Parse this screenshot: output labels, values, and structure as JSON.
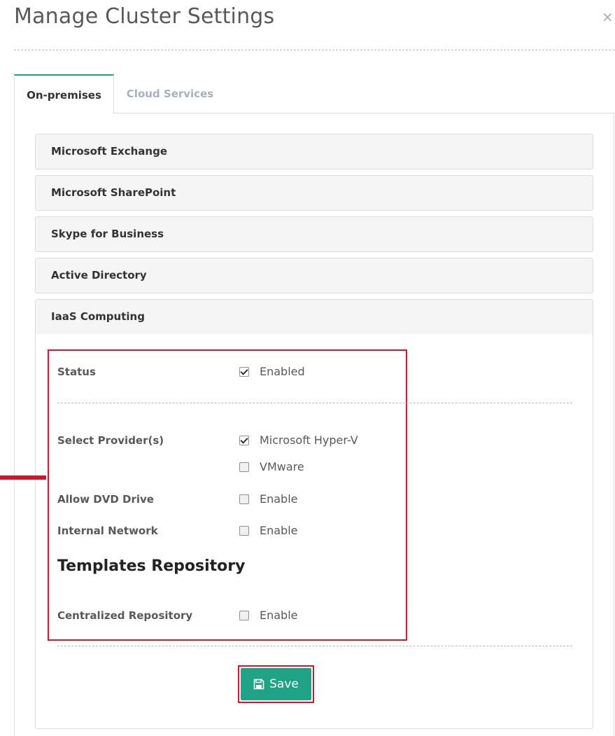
{
  "dialog": {
    "title": "Manage Cluster Settings",
    "close_glyph": "×"
  },
  "tabs": [
    {
      "label": "On-premises",
      "active": true
    },
    {
      "label": "Cloud Services",
      "active": false
    }
  ],
  "accordion": {
    "items": [
      {
        "label": "Microsoft Exchange"
      },
      {
        "label": "Microsoft SharePoint"
      },
      {
        "label": "Skype for Business"
      },
      {
        "label": "Active Directory"
      },
      {
        "label": "IaaS Computing",
        "expanded": true
      }
    ]
  },
  "iaas": {
    "status": {
      "label": "Status",
      "option": "Enabled",
      "checked": true
    },
    "providers": {
      "label": "Select Provider(s)",
      "options": [
        {
          "label": "Microsoft Hyper-V",
          "checked": true
        },
        {
          "label": "VMware",
          "checked": false
        }
      ]
    },
    "dvd": {
      "label": "Allow DVD Drive",
      "option": "Enable",
      "checked": false
    },
    "network": {
      "label": "Internal Network",
      "option": "Enable",
      "checked": false
    },
    "templates_title": "Templates Repository",
    "repository": {
      "label": "Centralized Repository",
      "option": "Enable",
      "checked": false
    }
  },
  "save_button": {
    "label": "Save",
    "icon": "floppy-disk-icon"
  },
  "colors": {
    "accent": "#1fa385",
    "highlight": "#d7142b",
    "panel_bg": "#f5f5f5"
  }
}
